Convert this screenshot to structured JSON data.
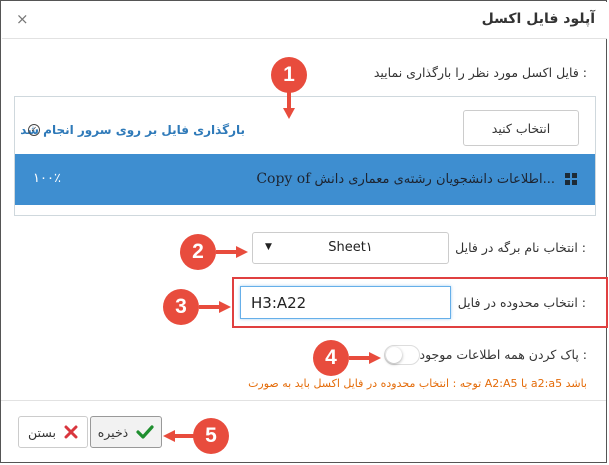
{
  "dialog": {
    "title": "آپلود فایل اکسل",
    "close_icon": "×"
  },
  "upload": {
    "instruction": "فایل اکسل مورد نظر را بارگذاری نمایید :",
    "select_button_label": "انتخاب کنید",
    "status_text": "بارگذاری فایل بر روی سرور انجام شد",
    "status_icon": "check-circle-icon",
    "file_name_prefix": "Copy of",
    "file_name_rest": "اطلاعات دانشجویان رشته‌ی معماری دانش...",
    "progress_percent": 100,
    "progress_label": "۱۰۰٪",
    "progress_color": "#3e8ed0"
  },
  "sheet": {
    "label": "انتخاب نام برگه در فایل :",
    "selected": "Sheet۱"
  },
  "range": {
    "label": "انتخاب محدوده در فایل :",
    "value": "H3:A22"
  },
  "clear": {
    "label": "پاک کردن همه اطلاعات موجود :",
    "enabled": false
  },
  "note": "توجه : انتخاب محدوده در فایل اکسل باید به صورت A2:A5 یا a2:a5 باشد",
  "buttons": {
    "save_label": "ذخیره",
    "close_label": "بستن"
  },
  "markers": [
    "1",
    "2",
    "3",
    "4",
    "5"
  ],
  "colors": {
    "marker": "#e84c3d",
    "status_text": "#2f7ab9",
    "note": "#e46c0a",
    "highlight_border": "#e04040"
  }
}
